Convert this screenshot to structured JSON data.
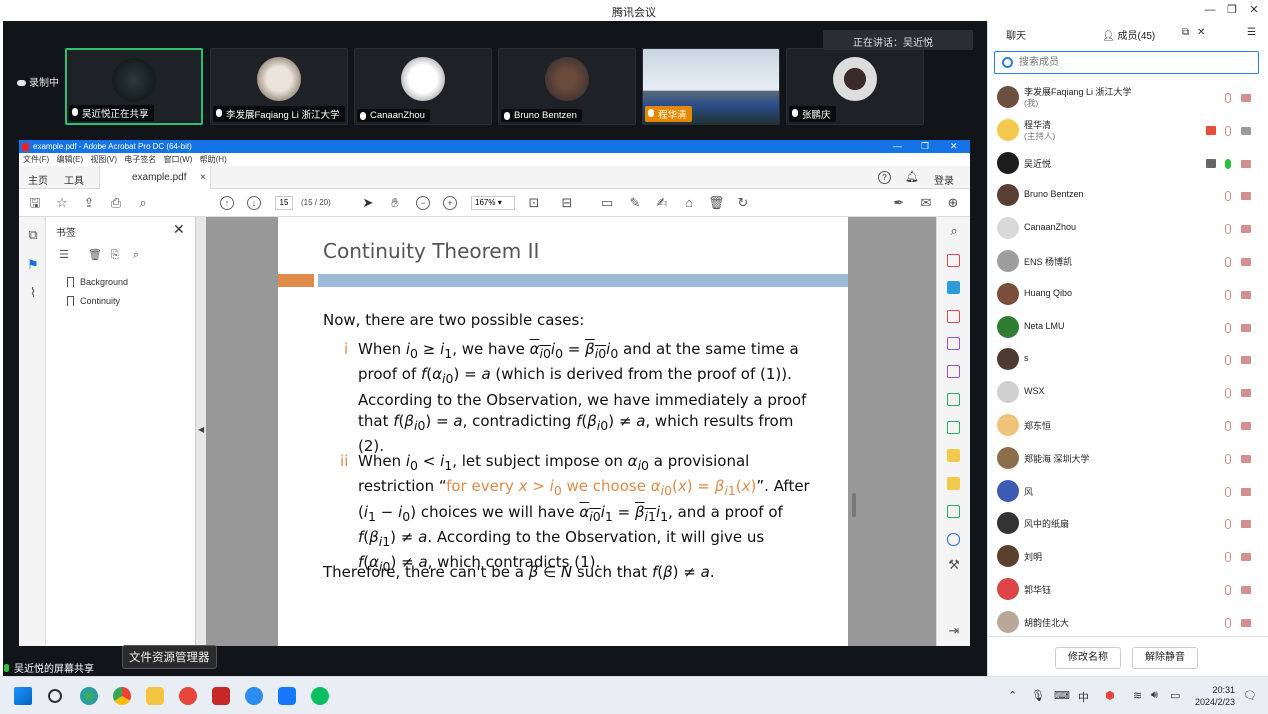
{
  "window": {
    "title": "腾讯会议"
  },
  "meeting": {
    "recording_label": "录制中",
    "speaking_label": "正在讲话：吴近悦",
    "participant_tiles": [
      {
        "name": "吴近悦正在共享",
        "active": true
      },
      {
        "name": "李发展Faqiang Li 浙江大学"
      },
      {
        "name": "CanaanZhou"
      },
      {
        "name": "Bruno Bentzen"
      },
      {
        "name": "程华清"
      },
      {
        "name": "张鹏庆"
      }
    ],
    "share_status": "吴近悦的屏幕共享",
    "tooltip": "文件资源管理器"
  },
  "acrobat": {
    "title": "example.pdf - Adobe Acrobat Pro DC (64-bit)",
    "menu": [
      "文件(F)",
      "编辑(E)",
      "视图(V)",
      "电子签名",
      "窗口(W)",
      "帮助(H)"
    ],
    "tabs": {
      "home": "主页",
      "tools": "工具",
      "doc": "example.pdf",
      "login": "登录"
    },
    "page_current": "15",
    "page_count": "(15 / 20)",
    "zoom": "167%",
    "bookmarks": {
      "header": "书签",
      "items": [
        "Background",
        "Continuity"
      ]
    }
  },
  "slide": {
    "title": "Continuity Theorem II",
    "intro": "Now, there are two possible cases:",
    "case_i_label": "i",
    "case_ii_label": "ii",
    "conclusion_prefix": "Therefore, there can't be a"
  },
  "panel": {
    "tab_chat": "聊天",
    "tab_members": "成员(45)",
    "search_placeholder": "搜索成员",
    "participants": [
      {
        "name": "李发展Faqiang Li 浙江大学",
        "role": "(我)"
      },
      {
        "name": "程华清",
        "role": "(主持人)"
      },
      {
        "name": "吴近悦"
      },
      {
        "name": "Bruno Bentzen"
      },
      {
        "name": "CanaanZhou"
      },
      {
        "name": "ENS 杨博凯"
      },
      {
        "name": "Huang Qibo"
      },
      {
        "name": "Neta LMU"
      },
      {
        "name": "s"
      },
      {
        "name": "WSX"
      },
      {
        "name": "郑东恒"
      },
      {
        "name": "郑能海 深圳大学"
      },
      {
        "name": "风"
      },
      {
        "name": "风中的纸扇"
      },
      {
        "name": "刘明"
      },
      {
        "name": "郭华钰"
      },
      {
        "name": "胡韵佳北大"
      }
    ],
    "rename_button": "修改名称",
    "unmute_button": "解除静音"
  },
  "taskbar": {
    "time": "20:31",
    "date": "2024/2/23"
  },
  "colors": {
    "accent": "#e08a4c",
    "bar": "#9dbbd5",
    "acrobat_blue": "#1473e6",
    "active_tile": "#2fbf71"
  }
}
